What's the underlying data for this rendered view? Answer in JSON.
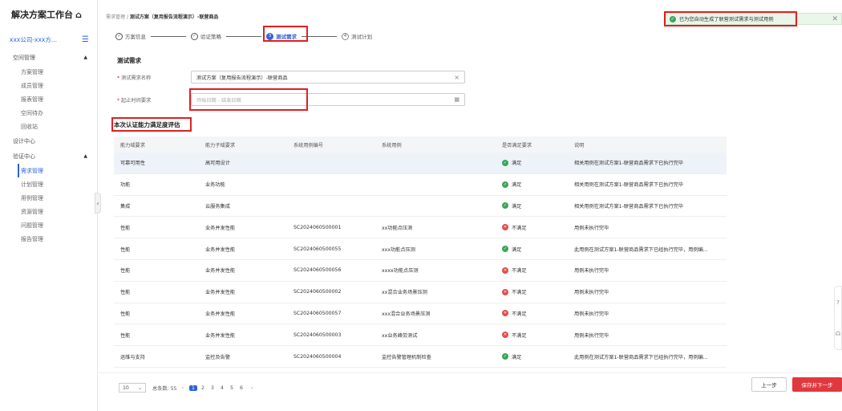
{
  "sidebar": {
    "brand": "解决方案工作台",
    "home_icon": "home-icon",
    "org": "xxx公司-xxx方...",
    "groups": [
      {
        "label": "空间管理",
        "items": [
          "方案管理",
          "成员管理",
          "报表管理",
          "空间待办",
          "回收站"
        ]
      },
      {
        "label": "设计中心",
        "items": []
      },
      {
        "label": "验证中心",
        "items": [
          "需求管理",
          "计划管理",
          "用例管理",
          "资源管理",
          "问题管理",
          "报告管理"
        ]
      }
    ],
    "active_item": "需求管理"
  },
  "breadcrumb": {
    "root": "需求管理",
    "sep": "/",
    "current": "测试方案（复用报告流程演示）-联营商品"
  },
  "toast": {
    "text": "已为您自动生成了联营测试需求与测试用例",
    "close": "✕"
  },
  "steps": [
    {
      "num": "✓",
      "label": "方案信息"
    },
    {
      "num": "✓",
      "label": "验证策略"
    },
    {
      "num": "3",
      "label": "测试需求"
    },
    {
      "num": "4",
      "label": "测试计划"
    }
  ],
  "form": {
    "title": "测试需求",
    "name_label": "测试需求名称",
    "name_value": "测试方案（复用报告流程演示）-联营商品",
    "time_label": "起止时间要求",
    "time_placeholder": "开始日期 - 结束日期"
  },
  "eval_title": "本次认证能力满足度评估",
  "table": {
    "headers": [
      "能力域要求",
      "能力子域要求",
      "系统用例编号",
      "系统用例",
      "是否满足要求",
      "说明"
    ],
    "rows": [
      {
        "domain": "可靠可用性",
        "sub": "高可用设计",
        "code": "",
        "case": "",
        "ok": true,
        "status": "满足",
        "note": "相关用例在测试方案1-联营商品需求下已执行完毕"
      },
      {
        "domain": "功能",
        "sub": "业务功能",
        "code": "",
        "case": "",
        "ok": true,
        "status": "满足",
        "note": "相关用例在测试方案1-联营商品需求下已执行完毕"
      },
      {
        "domain": "集成",
        "sub": "云服务集成",
        "code": "",
        "case": "",
        "ok": true,
        "status": "满足",
        "note": "相关用例在测试方案1-联营商品需求下已执行完毕"
      },
      {
        "domain": "性能",
        "sub": "业务并发性能",
        "code": "SC2024060500001",
        "case": "xx功能点压测",
        "ok": false,
        "status": "不满足",
        "note": "用例未执行完毕"
      },
      {
        "domain": "性能",
        "sub": "业务并发性能",
        "code": "SC2024060500055",
        "case": "xxx功能点压测",
        "ok": true,
        "status": "满足",
        "note": "此用例在测试方案1-联营商品需求下已经执行完毕，用例编..."
      },
      {
        "domain": "性能",
        "sub": "业务并发性能",
        "code": "SC2024060500056",
        "case": "xxxx功能点压测",
        "ok": false,
        "status": "不满足",
        "note": "用例未执行完毕"
      },
      {
        "domain": "性能",
        "sub": "业务并发性能",
        "code": "SC2024060500002",
        "case": "xx混合业务场景压测",
        "ok": false,
        "status": "不满足",
        "note": "用例未执行完毕"
      },
      {
        "domain": "性能",
        "sub": "业务并发性能",
        "code": "SC2024060500057",
        "case": "xxx混合业务场景压测",
        "ok": false,
        "status": "不满足",
        "note": "用例未执行完毕"
      },
      {
        "domain": "性能",
        "sub": "业务并发性能",
        "code": "SC2024060500003",
        "case": "xx业务峰劳测试",
        "ok": false,
        "status": "不满足",
        "note": "用例未执行完毕"
      },
      {
        "domain": "运维与支持",
        "sub": "监控及告警",
        "code": "SC2024060500004",
        "case": "监控告警管理机制检查",
        "ok": true,
        "status": "满足",
        "note": "此用例在测试方案1-联营商品需求下已经执行完毕，用例编..."
      }
    ]
  },
  "pager": {
    "size": "10",
    "total_label": "总条数: 55",
    "pages": [
      "1",
      "2",
      "3",
      "4",
      "5",
      "6"
    ],
    "current": "1"
  },
  "buttons": {
    "prev": "上一步",
    "next": "保存并下一步"
  },
  "colors": {
    "accent": "#2e63d6",
    "danger": "#e0383e",
    "ok": "#3ba55c"
  }
}
